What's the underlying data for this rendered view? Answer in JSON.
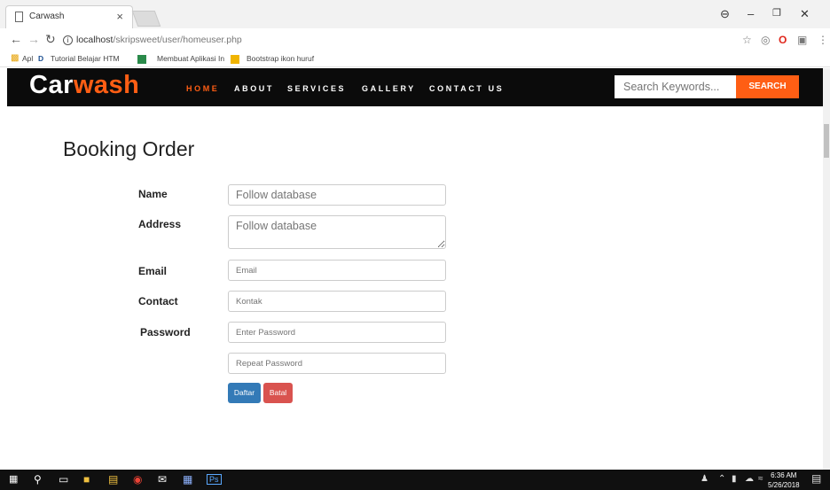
{
  "browser": {
    "tab_title": "Carwash",
    "tab_close": "×",
    "url_host": "localhost",
    "url_path": "/skripsweet/user/homeuser.php",
    "bookmarks": [
      "Apl",
      "Tutorial Belajar HTM",
      "Membuat Aplikasi In",
      "Bootstrap ikon huruf"
    ]
  },
  "site": {
    "logo_prefix": "Car",
    "logo_suffix": "wash",
    "nav": [
      "HOME",
      "ABOUT",
      "SERVICES",
      "GALLERY",
      "CONTACT US"
    ],
    "active_nav": "HOME",
    "search_placeholder": "Search Keywords...",
    "search_button": "SEARCH",
    "accent": "#ff5e14"
  },
  "form": {
    "title": "Booking Order",
    "labels": {
      "name": "Name",
      "address": "Address",
      "email": "Email",
      "contact": "Contact",
      "password": "Password"
    },
    "placeholders": {
      "name": "Follow database",
      "address": "Follow database",
      "email": "Email",
      "contact": "Kontak",
      "password": "Enter Password",
      "repeat_password": "Repeat Password"
    },
    "submit": "Daftar",
    "cancel": "Batal"
  },
  "taskbar": {
    "time": "6:36 AM",
    "date": "5/26/2018"
  }
}
